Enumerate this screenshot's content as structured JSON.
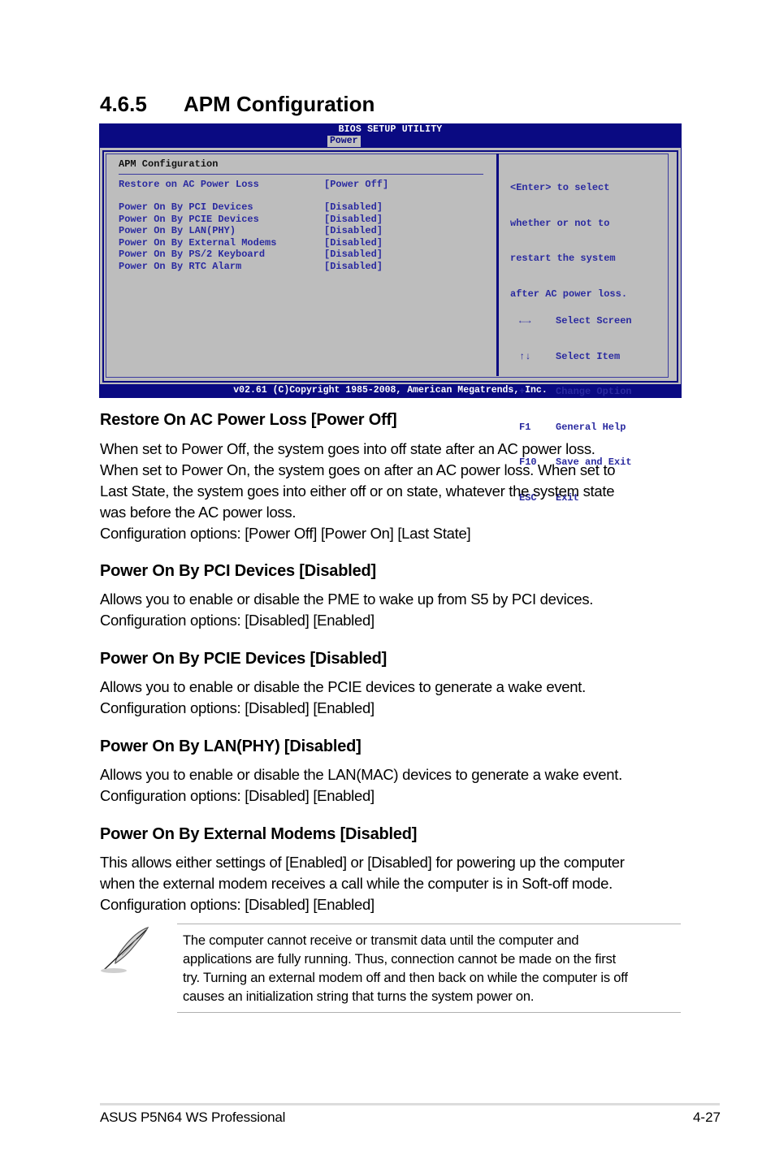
{
  "section": {
    "number": "4.6.5",
    "title": "APM Configuration"
  },
  "bios": {
    "title": "BIOS SETUP UTILITY",
    "active_tab": "Power",
    "panel_title": "APM Configuration",
    "items": [
      {
        "label": "Restore on AC Power Loss",
        "value": "[Power Off]"
      },
      {
        "label": "Power On By PCI Devices",
        "value": "[Disabled]"
      },
      {
        "label": "Power On By PCIE Devices",
        "value": "[Disabled]"
      },
      {
        "label": "Power On By LAN(PHY)",
        "value": "[Disabled]"
      },
      {
        "label": "Power On By External Modems",
        "value": "[Disabled]"
      },
      {
        "label": "Power On By PS/2 Keyboard",
        "value": "[Disabled]"
      },
      {
        "label": "Power On By RTC Alarm",
        "value": "[Disabled]"
      }
    ],
    "help_lines": [
      "<Enter> to select",
      "whether or not to",
      "restart the system",
      "after AC power loss."
    ],
    "keys": [
      {
        "key": "←→",
        "icon": "left-right-arrows-icon",
        "action": "Select Screen"
      },
      {
        "key": "↑↓",
        "icon": "up-down-arrows-icon",
        "action": "Select Item"
      },
      {
        "key": "+-",
        "action": "Change Option"
      },
      {
        "key": "F1",
        "action": "General Help"
      },
      {
        "key": "F10",
        "action": "Save and Exit"
      },
      {
        "key": "ESC",
        "action": "Exit"
      }
    ],
    "footer": "v02.61 (C)Copyright 1985-2008, American Megatrends, Inc."
  },
  "subsections": [
    {
      "heading": "Restore On AC Power Loss [Power Off]",
      "lines": [
        "When set to Power Off, the system goes into off state after an AC power loss.",
        "When set to Power On, the system goes on after an AC power loss. When set to",
        "Last State, the system goes into either off or on state, whatever the system state",
        "was before the AC power loss.",
        "Configuration options: [Power Off] [Power On] [Last State]"
      ]
    },
    {
      "heading": "Power On By PCI Devices [Disabled]",
      "lines": [
        "Allows you to enable or disable the PME to wake up from S5 by PCI devices.",
        "Configuration options: [Disabled] [Enabled]"
      ]
    },
    {
      "heading": "Power On By PCIE Devices [Disabled]",
      "lines": [
        "Allows you to enable or disable the PCIE devices to generate a wake event.",
        "Configuration options: [Disabled] [Enabled]"
      ]
    },
    {
      "heading": "Power On By LAN(PHY) [Disabled]",
      "lines": [
        "Allows you to enable or disable the LAN(MAC) devices to generate a wake event.",
        "Configuration options: [Disabled] [Enabled]"
      ]
    },
    {
      "heading": "Power On By External Modems [Disabled]",
      "lines": [
        "This allows either settings of [Enabled] or [Disabled] for powering up the computer",
        "when the external modem receives a call while the computer is in Soft-off mode.",
        "Configuration options: [Disabled] [Enabled]"
      ]
    }
  ],
  "note": {
    "icon": "feather-pen-icon",
    "lines": [
      "The computer cannot receive or transmit data until the computer and",
      "applications are fully running. Thus, connection cannot be made on the first",
      "try. Turning an external modem off and then back on while the computer is off",
      "causes an initialization string that turns the system power on."
    ]
  },
  "footer": {
    "product": "ASUS P5N64 WS Professional",
    "page": "4-27"
  }
}
